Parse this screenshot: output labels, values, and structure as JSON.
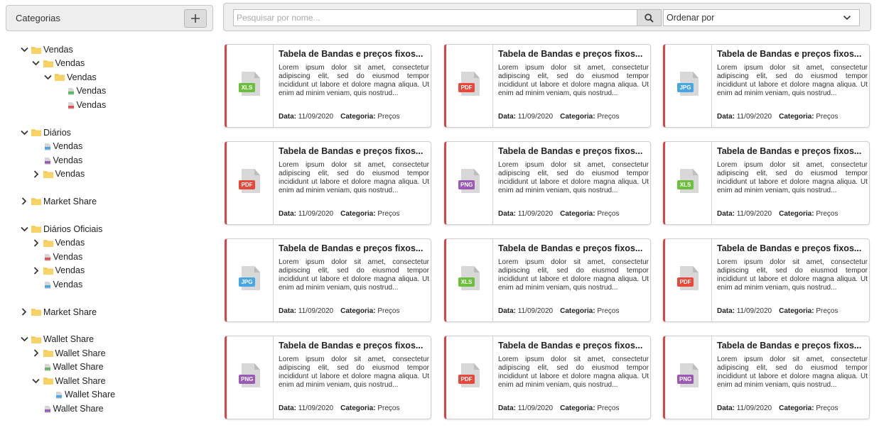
{
  "sidebar": {
    "title": "Categorias",
    "add_icon": "plus-icon",
    "tree": [
      {
        "label": "Vendas",
        "type": "folder",
        "level": 0,
        "chevron": "down",
        "row": 0
      },
      {
        "label": "Vendas",
        "type": "folder",
        "level": 1,
        "chevron": "down",
        "row": 1
      },
      {
        "label": "Vendas",
        "type": "folder",
        "level": 2,
        "chevron": "down",
        "row": 2
      },
      {
        "label": "Vendas",
        "type": "file",
        "file_color": "#5cb85c",
        "level": 3,
        "chevron": "none",
        "row": 3
      },
      {
        "label": "Vendas",
        "type": "file",
        "file_color": "#e05050",
        "level": 3,
        "chevron": "none",
        "row": 4
      },
      {
        "label": "Diários",
        "type": "folder",
        "level": 0,
        "chevron": "down",
        "row": 6
      },
      {
        "label": "Vendas",
        "type": "file",
        "file_color": "#47a6e6",
        "level": 1,
        "chevron": "none",
        "row": 7
      },
      {
        "label": "Vendas",
        "type": "file",
        "file_color": "#9b59b6",
        "level": 1,
        "chevron": "none",
        "row": 8
      },
      {
        "label": "Vendas",
        "type": "folder",
        "level": 1,
        "chevron": "right",
        "row": 9
      },
      {
        "label": "Market Share",
        "type": "folder",
        "level": 0,
        "chevron": "right",
        "row": 11
      },
      {
        "label": "Diários Oficiais",
        "type": "folder",
        "level": 0,
        "chevron": "down",
        "row": 13
      },
      {
        "label": "Vendas",
        "type": "folder",
        "level": 1,
        "chevron": "right",
        "row": 14
      },
      {
        "label": "Vendas",
        "type": "file",
        "file_color": "#e05050",
        "level": 1,
        "chevron": "none",
        "row": 15
      },
      {
        "label": "Vendas",
        "type": "folder",
        "level": 1,
        "chevron": "right",
        "row": 16
      },
      {
        "label": "Vendas",
        "type": "file",
        "file_color": "#47a6e6",
        "level": 1,
        "chevron": "none",
        "row": 17
      },
      {
        "label": "Market Share",
        "type": "folder",
        "level": 0,
        "chevron": "right",
        "row": 19
      },
      {
        "label": "Wallet Share",
        "type": "folder",
        "level": 0,
        "chevron": "down",
        "row": 21
      },
      {
        "label": "Wallet Share",
        "type": "folder",
        "level": 1,
        "chevron": "right",
        "row": 22
      },
      {
        "label": "Wallet Share",
        "type": "file",
        "file_color": "#5cb85c",
        "level": 1,
        "chevron": "none",
        "row": 23
      },
      {
        "label": "Wallet Share",
        "type": "folder",
        "level": 1,
        "chevron": "down",
        "row": 24
      },
      {
        "label": "Wallet Share",
        "type": "file",
        "file_color": "#47a6e6",
        "level": 2,
        "chevron": "none",
        "row": 25
      },
      {
        "label": "Wallet Share",
        "type": "file",
        "file_color": "#9b59b6",
        "level": 1,
        "chevron": "none",
        "row": 26
      }
    ]
  },
  "search": {
    "placeholder": "Pesquisar por nome...",
    "value": "",
    "icon": "search-icon"
  },
  "sort": {
    "selected": "Ordenar por",
    "icon": "chevron-down-icon"
  },
  "colors": {
    "card_accent": "#d94545",
    "folder": "#f5c84c",
    "XLS": "#6cbf3c",
    "PDF": "#e8483a",
    "JPG": "#47a6e6",
    "PNG": "#9b59b6"
  },
  "cards": [
    {
      "type": "XLS",
      "title": "Tabela de Bandas e preços fixos...",
      "description": "Lorem ipsum dolor sit amet, consectetur adipiscing elit, sed do eiusmod tempor incididunt ut labore et dolore magna aliqua. Ut enim ad minim veniam, quis nostrud...",
      "date_label": "Data:",
      "date": "11/09/2020",
      "category_label": "Categoria:",
      "category": "Preços"
    },
    {
      "type": "PDF",
      "title": "Tabela de Bandas e preços fixos...",
      "description": "Lorem ipsum dolor sit amet, consectetur adipiscing elit, sed do eiusmod tempor incididunt ut labore et dolore magna aliqua. Ut enim ad minim veniam, quis nostrud...",
      "date_label": "Data:",
      "date": "11/09/2020",
      "category_label": "Categoria:",
      "category": "Preços"
    },
    {
      "type": "JPG",
      "title": "Tabela de Bandas e preços fixos...",
      "description": "Lorem ipsum dolor sit amet, consectetur adipiscing elit, sed do eiusmod tempor incididunt ut labore et dolore magna aliqua. Ut enim ad minim veniam, quis nostrud...",
      "date_label": "Data:",
      "date": "11/09/2020",
      "category_label": "Categoria:",
      "category": "Preços"
    },
    {
      "type": "PDF",
      "title": "Tabela de Bandas e preços fixos...",
      "description": "Lorem ipsum dolor sit amet, consectetur adipiscing elit, sed do eiusmod tempor incididunt ut labore et dolore magna aliqua. Ut enim ad minim veniam, quis nostrud...",
      "date_label": "Data:",
      "date": "11/09/2020",
      "category_label": "Categoria:",
      "category": "Preços"
    },
    {
      "type": "PNG",
      "title": "Tabela de Bandas e preços fixos...",
      "description": "Lorem ipsum dolor sit amet, consectetur adipiscing elit, sed do eiusmod tempor incididunt ut labore et dolore magna aliqua. Ut enim ad minim veniam, quis nostrud...",
      "date_label": "Data:",
      "date": "11/09/2020",
      "category_label": "Categoria:",
      "category": "Preços"
    },
    {
      "type": "XLS",
      "title": "Tabela de Bandas e preços fixos...",
      "description": "Lorem ipsum dolor sit amet, consectetur adipiscing elit, sed do eiusmod tempor incididunt ut labore et dolore magna aliqua. Ut enim ad minim veniam, quis nostrud...",
      "date_label": "Data:",
      "date": "11/09/2020",
      "category_label": "Categoria:",
      "category": "Preços"
    },
    {
      "type": "JPG",
      "title": "Tabela de Bandas e preços fixos...",
      "description": "Lorem ipsum dolor sit amet, consectetur adipiscing elit, sed do eiusmod tempor incididunt ut labore et dolore magna aliqua. Ut enim ad minim veniam, quis nostrud...",
      "date_label": "Data:",
      "date": "11/09/2020",
      "category_label": "Categoria:",
      "category": "Preços"
    },
    {
      "type": "XLS",
      "title": "Tabela de Bandas e preços fixos...",
      "description": "Lorem ipsum dolor sit amet, consectetur adipiscing elit, sed do eiusmod tempor incididunt ut labore et dolore magna aliqua. Ut enim ad minim veniam, quis nostrud...",
      "date_label": "Data:",
      "date": "11/09/2020",
      "category_label": "Categoria:",
      "category": "Preços"
    },
    {
      "type": "PDF",
      "title": "Tabela de Bandas e preços fixos...",
      "description": "Lorem ipsum dolor sit amet, consectetur adipiscing elit, sed do eiusmod tempor incididunt ut labore et dolore magna aliqua. Ut enim ad minim veniam, quis nostrud...",
      "date_label": "Data:",
      "date": "11/09/2020",
      "category_label": "Categoria:",
      "category": "Preços"
    },
    {
      "type": "PNG",
      "title": "Tabela de Bandas e preços fixos...",
      "description": "Lorem ipsum dolor sit amet, consectetur adipiscing elit, sed do eiusmod tempor incididunt ut labore et dolore magna aliqua. Ut enim ad minim veniam, quis nostrud...",
      "date_label": "Data:",
      "date": "11/09/2020",
      "category_label": "Categoria:",
      "category": "Preços"
    },
    {
      "type": "PDF",
      "title": "Tabela de Bandas e preços fixos...",
      "description": "Lorem ipsum dolor sit amet, consectetur adipiscing elit, sed do eiusmod tempor incididunt ut labore et dolore magna aliqua. Ut enim ad minim veniam, quis nostrud...",
      "date_label": "Data:",
      "date": "11/09/2020",
      "category_label": "Categoria:",
      "category": "Preços"
    },
    {
      "type": "PNG",
      "title": "Tabela de Bandas e preços fixos...",
      "description": "Lorem ipsum dolor sit amet, consectetur adipiscing elit, sed do eiusmod tempor incididunt ut labore et dolore magna aliqua. Ut enim ad minim veniam, quis nostrud...",
      "date_label": "Data:",
      "date": "11/09/2020",
      "category_label": "Categoria:",
      "category": "Preços"
    }
  ]
}
